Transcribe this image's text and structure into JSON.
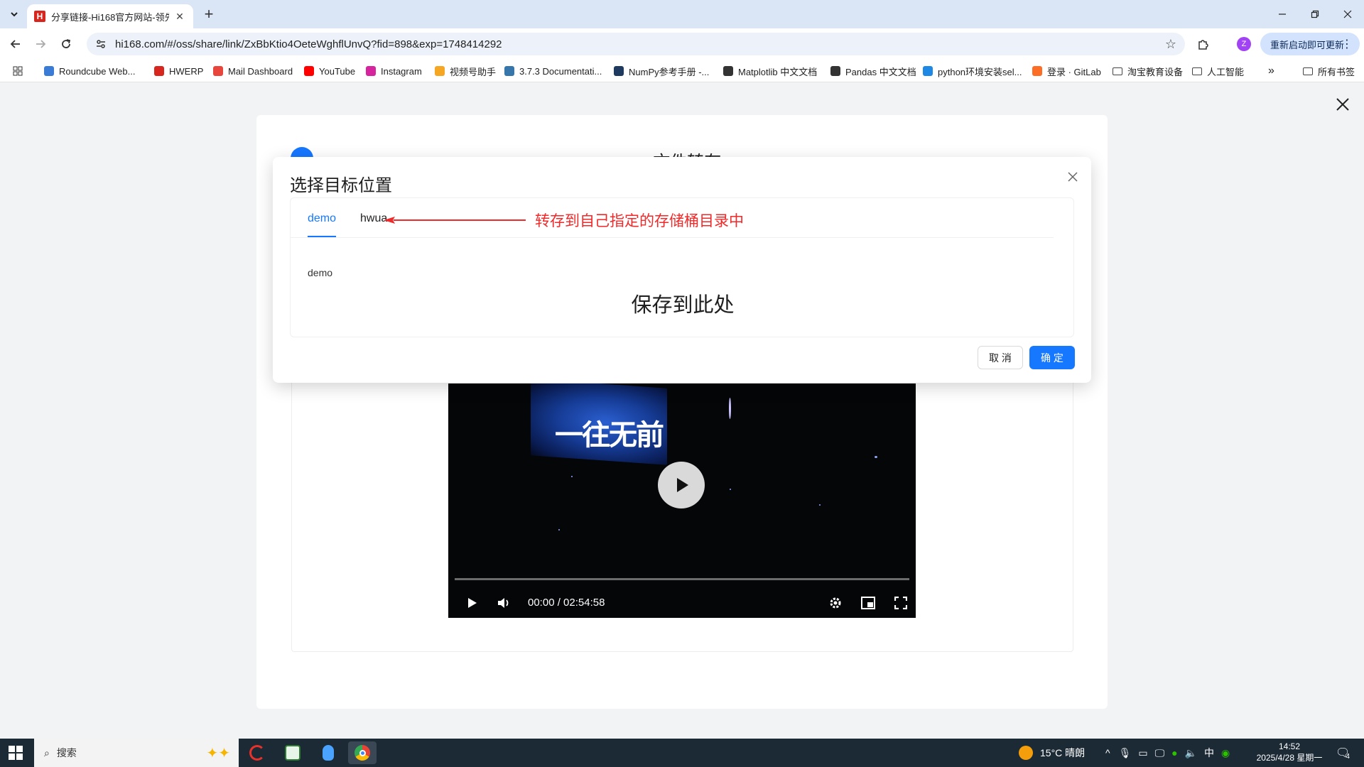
{
  "browser": {
    "tab_title": "分享链接-Hi168官方网站-领先",
    "favicon_letter": "H",
    "url": "hi168.com/#/oss/share/link/ZxBbKtio4OeteWghflUnvQ?fid=898&exp=1748414292",
    "profile_initial": "Z",
    "update_label": "重新启动即可更新",
    "bookmarks": [
      {
        "label": "Roundcube Web...",
        "color": "#3a7bd5"
      },
      {
        "label": "HWERP",
        "color": "#d7261e"
      },
      {
        "label": "Mail Dashboard",
        "color": "#e8453c"
      },
      {
        "label": "YouTube",
        "color": "#ff0000"
      },
      {
        "label": "Instagram",
        "color": "#d6249f"
      },
      {
        "label": "视频号助手",
        "color": "#f5a623"
      },
      {
        "label": "3.7.3 Documentati...",
        "color": "#3776ab"
      },
      {
        "label": "NumPy参考手册 -...",
        "color": "#1f3a5f"
      },
      {
        "label": "Matplotlib 中文文档",
        "color": "#333333"
      },
      {
        "label": "Pandas 中文文档",
        "color": "#333333"
      },
      {
        "label": "python环境安装sel...",
        "color": "#1e88e5"
      },
      {
        "label": "登录 · GitLab",
        "color": "#fc6d26"
      },
      {
        "label": "淘宝教育设备",
        "color": "folder"
      },
      {
        "label": "人工智能",
        "color": "folder"
      }
    ],
    "all_bookmarks_label": "所有书签"
  },
  "page": {
    "step_title": "文件转存",
    "video": {
      "overlay_text": "一往无前",
      "time": "00:00 / 02:54:58",
      "progress": 0
    }
  },
  "modal": {
    "title": "选择目标位置",
    "tabs": [
      {
        "label": "demo",
        "active": true
      },
      {
        "label": "hwua",
        "active": false
      }
    ],
    "annotation": "转存到自己指定的存储桶目录中",
    "bucket_label": "demo",
    "save_here": "保存到此处",
    "cancel_label": "取 消",
    "ok_label": "确 定"
  },
  "taskbar": {
    "search_placeholder": "搜索",
    "weather": "15°C  晴朗",
    "ime": "中",
    "time": "14:52",
    "date": "2025/4/28 星期一",
    "notification_count": "4"
  },
  "colors": {
    "accent": "#1677ff",
    "annotation": "#f02a2a"
  }
}
